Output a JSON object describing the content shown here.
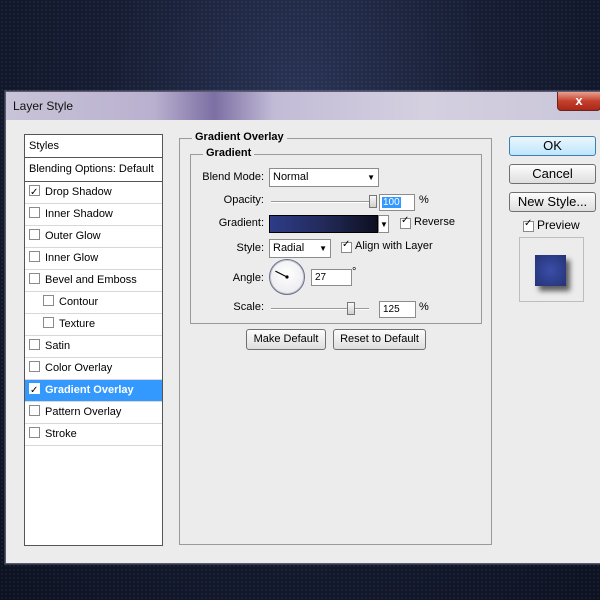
{
  "window": {
    "title": "Layer Style",
    "close_glyph": "x"
  },
  "styles_list": {
    "header": "Styles",
    "blending_options": "Blending Options: Default",
    "items": [
      {
        "label": "Drop Shadow",
        "checked": true,
        "selected": false,
        "indent": false
      },
      {
        "label": "Inner Shadow",
        "checked": false,
        "selected": false,
        "indent": false
      },
      {
        "label": "Outer Glow",
        "checked": false,
        "selected": false,
        "indent": false
      },
      {
        "label": "Inner Glow",
        "checked": false,
        "selected": false,
        "indent": false
      },
      {
        "label": "Bevel and Emboss",
        "checked": false,
        "selected": false,
        "indent": false
      },
      {
        "label": "Contour",
        "checked": false,
        "selected": false,
        "indent": true
      },
      {
        "label": "Texture",
        "checked": false,
        "selected": false,
        "indent": true
      },
      {
        "label": "Satin",
        "checked": false,
        "selected": false,
        "indent": false
      },
      {
        "label": "Color Overlay",
        "checked": false,
        "selected": false,
        "indent": false
      },
      {
        "label": "Gradient Overlay",
        "checked": true,
        "selected": true,
        "indent": false
      },
      {
        "label": "Pattern Overlay",
        "checked": false,
        "selected": false,
        "indent": false
      },
      {
        "label": "Stroke",
        "checked": false,
        "selected": false,
        "indent": false
      }
    ]
  },
  "gradient_overlay": {
    "group_title": "Gradient Overlay",
    "subgroup_title": "Gradient",
    "blend_mode": {
      "label": "Blend Mode:",
      "value": "Normal"
    },
    "opacity": {
      "label": "Opacity:",
      "value": "100",
      "unit": "%",
      "level": 1.0
    },
    "gradient": {
      "label": "Gradient:",
      "reverse_label": "Reverse",
      "reverse_checked": true,
      "colors": [
        "#2d3c88",
        "#222a5a",
        "#0e0f20"
      ]
    },
    "style": {
      "label": "Style:",
      "value": "Radial",
      "align_label": "Align with Layer",
      "align_checked": true
    },
    "angle": {
      "label": "Angle:",
      "value": "27",
      "unit": "°"
    },
    "scale": {
      "label": "Scale:",
      "value": "125",
      "unit": "%",
      "level": 0.83
    },
    "make_default": "Make Default",
    "reset_default": "Reset to Default"
  },
  "right_panel": {
    "ok": "OK",
    "cancel": "Cancel",
    "new_style": "New Style...",
    "preview_label": "Preview",
    "preview_checked": true
  },
  "colors": {
    "selection": "#3399ff",
    "dialog_bg": "#ececec"
  }
}
